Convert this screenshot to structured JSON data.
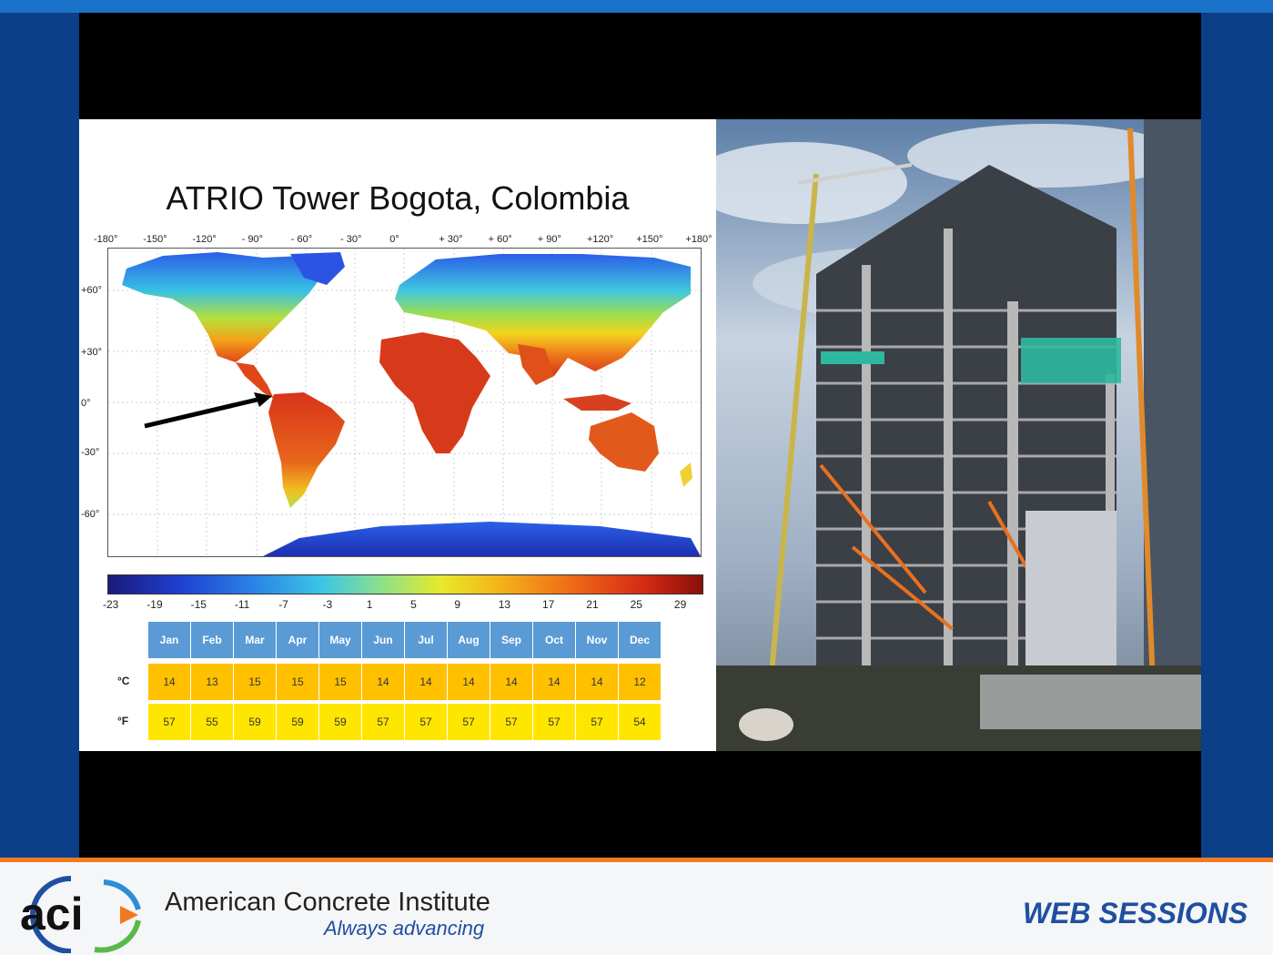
{
  "slide": {
    "title": "ATRIO Tower Bogota, Colombia",
    "longitudes": [
      "-180°",
      "-150°",
      "-120°",
      "- 90°",
      "- 60°",
      "- 30°",
      "0°",
      "+ 30°",
      "+ 60°",
      "+ 90°",
      "+120°",
      "+150°",
      "+180°"
    ],
    "latitudes": [
      "+60°",
      "+30°",
      "0°",
      "-30°",
      "-60°"
    ],
    "colorbar_labels": [
      "-23",
      "-19",
      "-15",
      "-11",
      "-7",
      "-3",
      "1",
      "5",
      "9",
      "13",
      "17",
      "21",
      "25",
      "29"
    ],
    "table": {
      "months": [
        "Jan",
        "Feb",
        "Mar",
        "Apr",
        "May",
        "Jun",
        "Jul",
        "Aug",
        "Sep",
        "Oct",
        "Nov",
        "Dec"
      ],
      "celsius_label": "°C",
      "fahrenheit_label": "°F",
      "celsius": [
        "14",
        "13",
        "15",
        "15",
        "15",
        "14",
        "14",
        "14",
        "14",
        "14",
        "14",
        "12"
      ],
      "fahrenheit": [
        "57",
        "55",
        "59",
        "59",
        "59",
        "57",
        "57",
        "57",
        "57",
        "57",
        "57",
        "54"
      ]
    }
  },
  "footer": {
    "logo_text": "aci",
    "org_name": "American Concrete Institute",
    "tagline": "Always advancing",
    "web_sessions": "WEB SESSIONS"
  },
  "colors": {
    "footer_accent": "#f07a20",
    "brand_blue": "#1f4fa0",
    "header_cell": "#5b9bd5",
    "celsius_cell": "#ffc000",
    "fahrenheit_cell": "#ffe600"
  }
}
